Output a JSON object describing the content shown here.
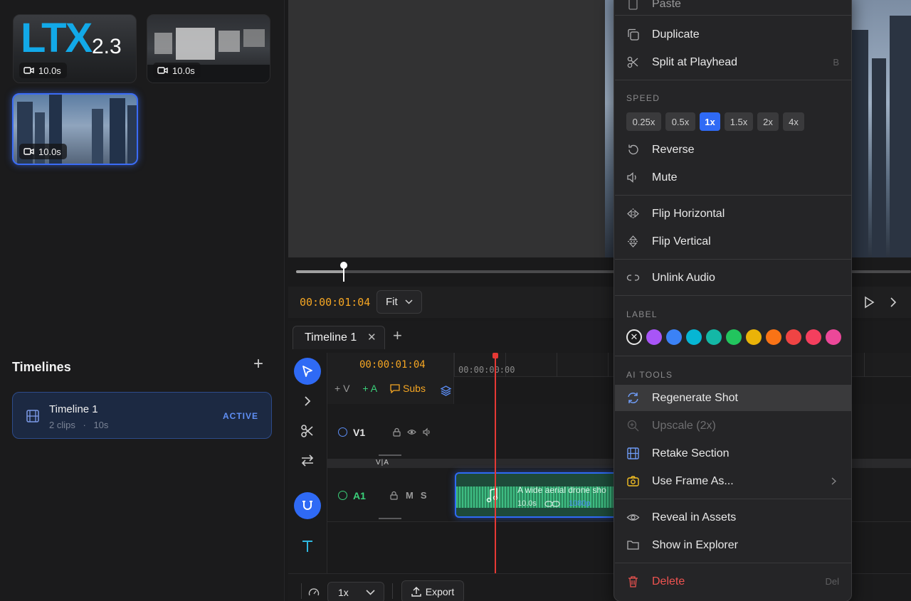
{
  "assets": [
    {
      "logo": "LTX",
      "version": "2.3",
      "duration": "10.0s"
    },
    {
      "duration": "10.0s"
    },
    {
      "duration": "10.0s"
    }
  ],
  "timelines": {
    "title": "Timelines",
    "add": "+",
    "card": {
      "name": "Timeline 1",
      "clips": "2 clips",
      "sep": "·",
      "length": "10s",
      "status": "ACTIVE"
    }
  },
  "transport": {
    "timecode": "00:00:01:04",
    "fit": "Fit"
  },
  "tabs": {
    "active": "Timeline 1",
    "close": "✕",
    "add": "+"
  },
  "timeline": {
    "ruler_time": "00:00:01:04",
    "ruler_label": "00:00:00:00",
    "add_video": "+ V",
    "add_audio": "+ A",
    "subs": "Subs",
    "va_divider": "V|A",
    "v1": "V1",
    "a1": "A1",
    "a1_mute": "M",
    "a1_solo": "S",
    "clip": {
      "title": "A wide aerial drone sho",
      "duration": "10.0s",
      "resolution": "1080p"
    }
  },
  "bottom": {
    "speed": "1x",
    "export": "Export"
  },
  "menu": {
    "top_items": [
      {
        "label": "Paste",
        "shortcut": ""
      },
      {
        "label": "Duplicate",
        "shortcut": ""
      },
      {
        "label": "Split at Playhead",
        "shortcut": "B"
      }
    ],
    "speed_section": "SPEED",
    "speeds": [
      "0.25x",
      "0.5x",
      "1x",
      "1.5x",
      "2x",
      "4x"
    ],
    "selected_speed": "1x",
    "reverse": "Reverse",
    "mute": "Mute",
    "flip_h": "Flip Horizontal",
    "flip_v": "Flip Vertical",
    "unlink": "Unlink Audio",
    "label_section": "LABEL",
    "label_colors": [
      "#a855f7",
      "#3b82f6",
      "#06b6d4",
      "#14b8a6",
      "#22c55e",
      "#eab308",
      "#f97316",
      "#ef4444",
      "#f43f5e",
      "#ec4899"
    ],
    "ai_section": "AI TOOLS",
    "regenerate": "Regenerate Shot",
    "upscale": "Upscale (2x)",
    "retake": "Retake Section",
    "use_frame": "Use Frame As...",
    "reveal": "Reveal in Assets",
    "show_explorer": "Show in Explorer",
    "delete": "Delete",
    "delete_shortcut": "Del"
  },
  "colors": {
    "accent": "#2f6af5",
    "timecode": "#f5a623",
    "playhead": "#e53935",
    "audio": "#3ad07a",
    "danger": "#ef5350"
  }
}
